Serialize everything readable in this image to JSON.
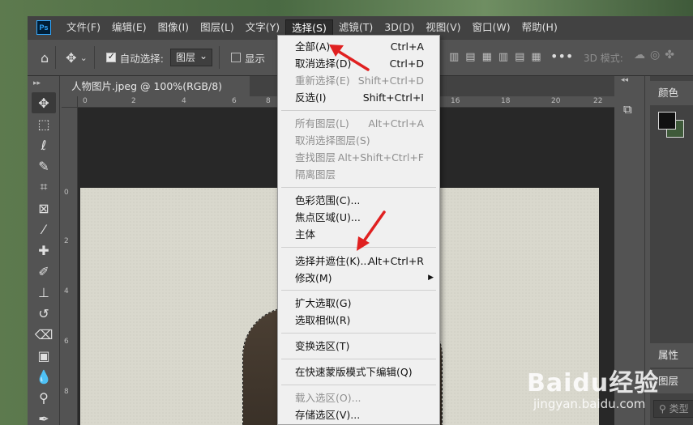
{
  "menubar": {
    "logo": "Ps",
    "items": [
      {
        "label": "文件(F)"
      },
      {
        "label": "编辑(E)"
      },
      {
        "label": "图像(I)"
      },
      {
        "label": "图层(L)"
      },
      {
        "label": "文字(Y)"
      },
      {
        "label": "选择(S)",
        "active": true
      },
      {
        "label": "滤镜(T)"
      },
      {
        "label": "3D(D)"
      },
      {
        "label": "视图(V)"
      },
      {
        "label": "窗口(W)"
      },
      {
        "label": "帮助(H)"
      }
    ]
  },
  "options_bar": {
    "auto_select_label": "自动选择:",
    "auto_select_checked": true,
    "layer_select_value": "图层",
    "show_label": "显示",
    "threed_mode_label": "3D 模式:"
  },
  "document": {
    "tab_title": "人物图片.jpeg @ 100%(RGB/8)",
    "ruler_h": [
      "0",
      "2",
      "4",
      "6",
      "8",
      "10",
      "12",
      "14",
      "16",
      "18",
      "20",
      "22"
    ],
    "ruler_v": [
      "0",
      "2",
      "4",
      "6",
      "8"
    ]
  },
  "right_panel": {
    "color_tab": "颜色",
    "properties_tab": "属性",
    "layers_tab": "图层",
    "search_placeholder": "类型"
  },
  "select_menu": {
    "items": [
      {
        "label": "全部(A)",
        "shortcut": "Ctrl+A",
        "enabled": true
      },
      {
        "label": "取消选择(D)",
        "shortcut": "Ctrl+D",
        "enabled": true
      },
      {
        "label": "重新选择(E)",
        "shortcut": "Shift+Ctrl+D",
        "enabled": false
      },
      {
        "label": "反选(I)",
        "shortcut": "Shift+Ctrl+I",
        "enabled": true
      },
      {
        "label": "所有图层(L)",
        "shortcut": "Alt+Ctrl+A",
        "enabled": false
      },
      {
        "label": "取消选择图层(S)",
        "shortcut": "",
        "enabled": false
      },
      {
        "label": "查找图层",
        "shortcut": "Alt+Shift+Ctrl+F",
        "enabled": false
      },
      {
        "label": "隔离图层",
        "shortcut": "",
        "enabled": false
      },
      {
        "label": "色彩范围(C)...",
        "shortcut": "",
        "enabled": true
      },
      {
        "label": "焦点区域(U)...",
        "shortcut": "",
        "enabled": true
      },
      {
        "label": "主体",
        "shortcut": "",
        "enabled": true
      },
      {
        "label": "选择并遮住(K)...",
        "shortcut": "Alt+Ctrl+R",
        "enabled": true
      },
      {
        "label": "修改(M)",
        "shortcut": "",
        "enabled": true,
        "submenu": true
      },
      {
        "label": "扩大选取(G)",
        "shortcut": "",
        "enabled": true
      },
      {
        "label": "选取相似(R)",
        "shortcut": "",
        "enabled": true
      },
      {
        "label": "变换选区(T)",
        "shortcut": "",
        "enabled": true
      },
      {
        "label": "在快速蒙版模式下编辑(Q)",
        "shortcut": "",
        "enabled": true
      },
      {
        "label": "载入选区(O)...",
        "shortcut": "",
        "enabled": false
      },
      {
        "label": "存储选区(V)...",
        "shortcut": "",
        "enabled": true
      }
    ]
  },
  "watermark": {
    "brand": "Baidu经验",
    "url": "jingyan.baidu.com"
  },
  "colors": {
    "annotation_arrow": "#e02020",
    "foreground_swatch": "#111111",
    "background_swatch": "#3f5a3a"
  }
}
